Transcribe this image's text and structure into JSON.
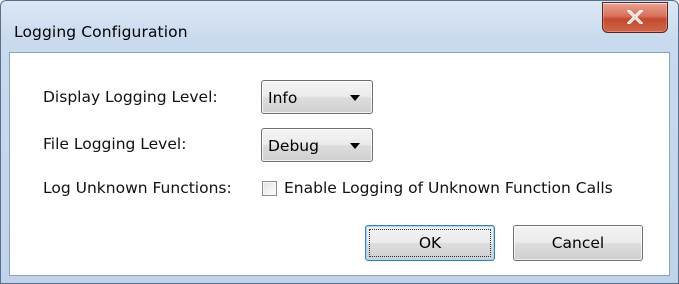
{
  "window": {
    "title": "Logging Configuration"
  },
  "form": {
    "display_level_label": "Display Logging Level:",
    "display_level_value": "Info",
    "file_level_label": "File Logging Level:",
    "file_level_value": "Debug",
    "unknown_functions_label": "Log Unknown Functions:",
    "unknown_functions_checkbox_label": "Enable Logging of Unknown Function Calls",
    "unknown_functions_checked": false
  },
  "buttons": {
    "ok_label": "OK",
    "cancel_label": "Cancel"
  },
  "icons": {
    "close": "close-icon",
    "dropdown": "chevron-down-icon"
  },
  "colors": {
    "close_button": "#d0654a",
    "title_bar": "#c9daee"
  }
}
